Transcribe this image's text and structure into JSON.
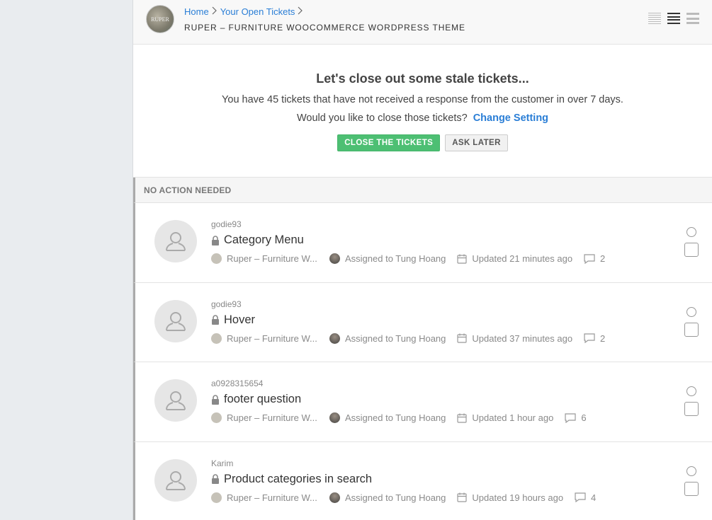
{
  "header": {
    "breadcrumb": {
      "home": "Home",
      "open_tickets": "Your Open Tickets"
    },
    "product_title": "RUPER – FURNITURE WOOCOMMERCE WORDPRESS THEME",
    "product_logo_text": "RUPER",
    "view_icons": [
      "compact-view-icon",
      "normal-view-icon",
      "wide-view-icon"
    ]
  },
  "stale": {
    "heading": "Let's close out some stale tickets...",
    "message": "You have 45 tickets that have not received a response from the customer in over 7 days.",
    "question": "Would you like to close those tickets?",
    "change_setting": "Change Setting",
    "close_button": "CLOSE THE TICKETS",
    "later_button": "ASK LATER"
  },
  "section": {
    "title": "NO ACTION NEEDED"
  },
  "tickets": [
    {
      "user": "godie93",
      "title": "Category Menu",
      "product": "Ruper – Furniture W...",
      "assigned": "Assigned to Tung Hoang",
      "updated": "Updated 21 minutes ago",
      "replies": "2"
    },
    {
      "user": "godie93",
      "title": "Hover",
      "product": "Ruper – Furniture W...",
      "assigned": "Assigned to Tung Hoang",
      "updated": "Updated 37 minutes ago",
      "replies": "2"
    },
    {
      "user": "a0928315654",
      "title": "footer question",
      "product": "Ruper – Furniture W...",
      "assigned": "Assigned to Tung Hoang",
      "updated": "Updated 1 hour ago",
      "replies": "6"
    },
    {
      "user": "Karim",
      "title": "Product categories in search",
      "product": "Ruper – Furniture W...",
      "assigned": "Assigned to Tung Hoang",
      "updated": "Updated 19 hours ago",
      "replies": "4"
    }
  ],
  "colors": {
    "accent": "#2a7ed6",
    "success": "#4dbf73"
  }
}
